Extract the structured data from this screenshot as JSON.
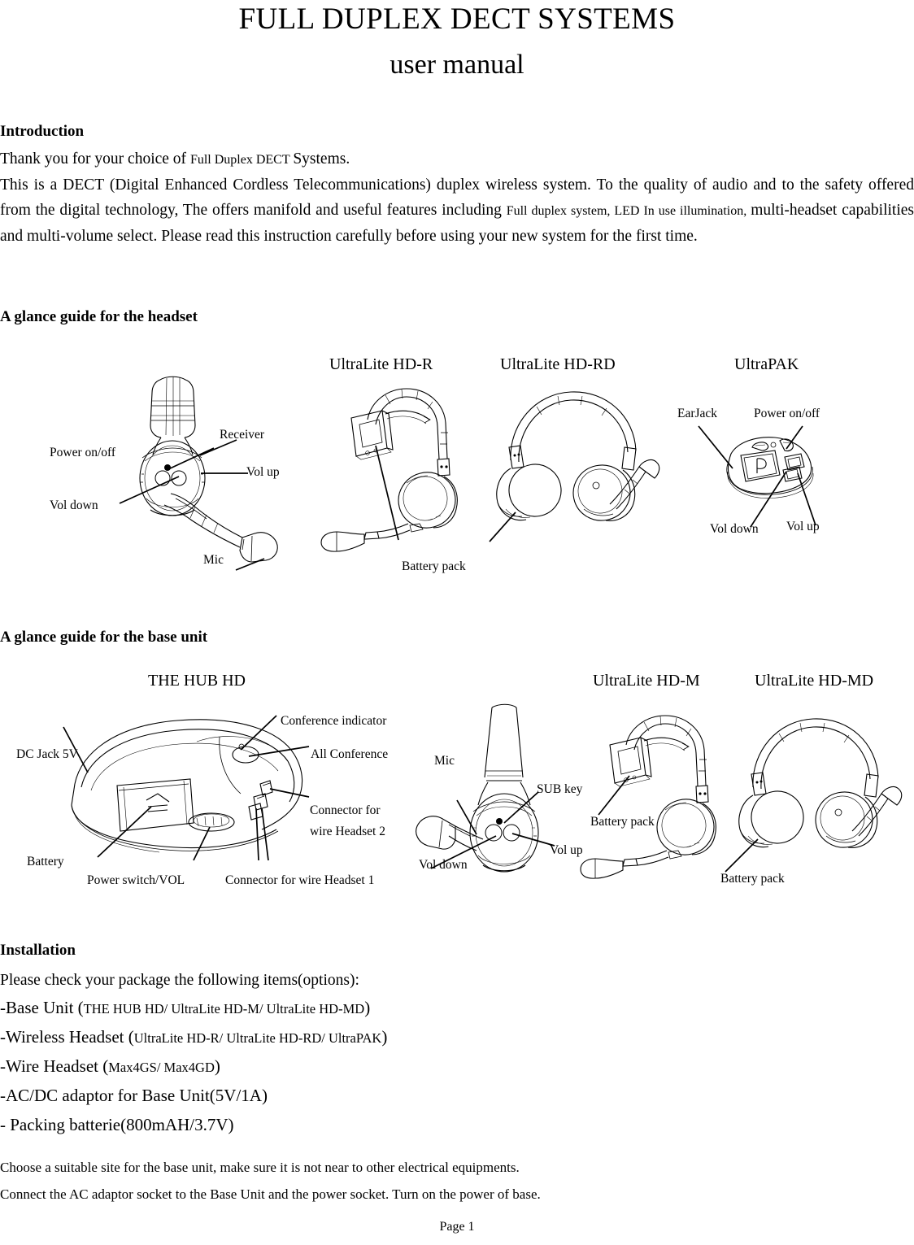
{
  "document": {
    "title": "FULL DUPLEX DECT SYSTEMS",
    "subtitle": "user manual",
    "page_footer": "Page 1"
  },
  "introduction": {
    "heading": "Introduction",
    "line1_a": "Thank you for your choice of ",
    "line1_b": "Full Duplex DECT ",
    "line1_c": "Systems.",
    "body_a": "This is a DECT (Digital Enhanced Cordless Telecommunications) duplex wireless system. To the quality of audio and to the safety offered from the digital technology, The offers manifold and useful features including ",
    "body_b": "Full duplex system, LED In use illumination, ",
    "body_c": "multi-headset capabilities and multi-volume select. Please read this instruction carefully before using your new system for the first time."
  },
  "headset_section": {
    "heading": "A glance guide for the headset",
    "devices": [
      {
        "name": "UltraLite HD-R"
      },
      {
        "name": "UltraLite HD-RD"
      },
      {
        "name": "UltraPAK"
      }
    ],
    "labels_main_headset": {
      "power": "Power on/off",
      "receiver": "Receiver",
      "vol_up": "Vol up",
      "vol_down": "Vol down",
      "mic": "Mic"
    },
    "labels_hdr": {
      "battery_pack": "Battery pack"
    },
    "labels_ultrapak": {
      "earjack": "EarJack",
      "power": "Power on/off",
      "vol_down": "Vol down",
      "vol_up": "Vol up"
    }
  },
  "base_section": {
    "heading": "A glance guide for the base unit",
    "devices": [
      {
        "name": "THE HUB HD"
      },
      {
        "name": "UltraLite HD-M"
      },
      {
        "name": "UltraLite HD-MD"
      }
    ],
    "labels_hub": {
      "dc_jack": "DC Jack 5V",
      "conference_indicator": "Conference indicator",
      "all_conference": "All Conference",
      "connector2_line1": "Connector for",
      "connector2_line2": "wire Headset 2",
      "battery": "Battery",
      "power_switch": "Power switch/VOL",
      "connector1": "Connector for wire Headset 1"
    },
    "labels_hdm_mic": {
      "mic": "Mic",
      "sub_key": "SUB key",
      "vol_up": "Vol up",
      "vol_down": "Vol down"
    },
    "labels_hdm": {
      "battery_pack": "Battery pack"
    },
    "labels_hdmd": {
      "battery_pack": "Battery pack"
    }
  },
  "installation": {
    "heading": "Installation",
    "intro": "Please check your package the following items(options):",
    "items": [
      {
        "main": "-Base Unit (",
        "detail": "THE HUB HD/ UltraLite HD-M/ UltraLite HD-MD",
        "close": ")"
      },
      {
        "main": "-Wireless Headset (",
        "detail": "UltraLite HD-R/ UltraLite HD-RD/ UltraPAK",
        "close": ")"
      },
      {
        "main": "-Wire Headset (",
        "detail": "Max4GS/ Max4GD",
        "close": ")"
      },
      {
        "main": "-AC/DC adaptor for Base Unit(5V/1A)",
        "detail": "",
        "close": ""
      },
      {
        "main": "- Packing batterie(800mAH/3.7V)",
        "detail": "",
        "close": ""
      }
    ],
    "note1": "Choose a suitable site for the base unit, make sure it is not near to other electrical equipments.",
    "note2": "Connect the AC adaptor socket to the Base Unit and the power socket. Turn on the power of base."
  }
}
